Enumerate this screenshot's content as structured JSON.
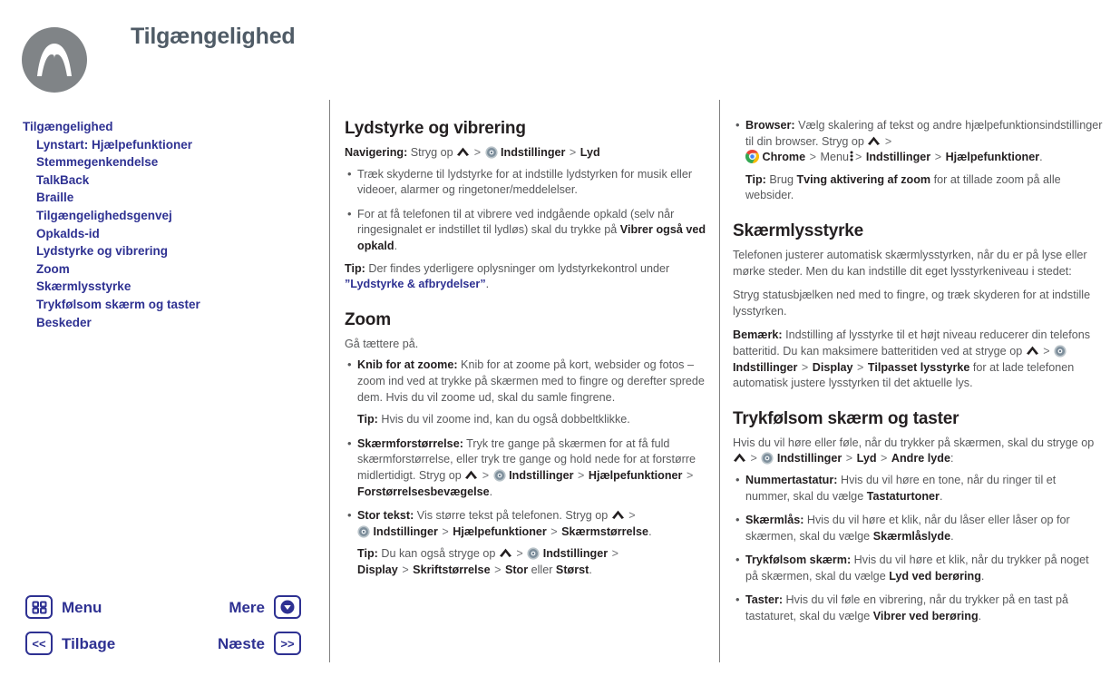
{
  "header": {
    "title": "Tilgængelighed",
    "logo_name": "motorola-logo"
  },
  "sidebar": {
    "items": [
      {
        "label": "Tilgængelighed",
        "level": 0
      },
      {
        "label": "Lynstart: Hjælpefunktioner",
        "level": 1
      },
      {
        "label": "Stemmegenkendelse",
        "level": 1
      },
      {
        "label": "TalkBack",
        "level": 1
      },
      {
        "label": "Braille",
        "level": 1
      },
      {
        "label": "Tilgængelighedsgenvej",
        "level": 1
      },
      {
        "label": "Opkalds-id",
        "level": 1
      },
      {
        "label": "Lydstyrke og vibrering",
        "level": 1
      },
      {
        "label": "Zoom",
        "level": 1
      },
      {
        "label": "Skærmlysstyrke",
        "level": 1
      },
      {
        "label": "Trykfølsom skærm og taster",
        "level": 1
      },
      {
        "label": "Beskeder",
        "level": 1
      }
    ]
  },
  "bottom_nav": {
    "menu_label": "Menu",
    "back_label": "Tilbage",
    "more_label": "Mere",
    "next_label": "Næste",
    "menu_icon": "grid-icon",
    "back_icon": "double-chevron-left-icon",
    "more_icon": "circle-chevron-down-icon",
    "next_icon": "double-chevron-right-icon"
  },
  "colors": {
    "nav_blue": "#2e3192",
    "body_grey": "#58595b",
    "heading_black": "#231f20",
    "logo_grey": "#808487",
    "title_slate": "#4f5b66"
  },
  "middle_column": {
    "section1": {
      "heading": "Lydstyrke og vibrering",
      "nav_label": "Navigering:",
      "nav_step1": "Stryg op",
      "nav_step2": "Indstillinger",
      "nav_step3": "Lyd",
      "bullet1": "Træk skyderne til lydstyrke for at indstille lydstyrken for musik eller videoer, alarmer og ringetoner/meddelelser.",
      "bullet2_a": "For at få telefonen til at vibrere ved indgående opkald (selv når ringesignalet er indstillet til lydløs) skal du trykke på ",
      "bullet2_b": "Vibrer også ved opkald",
      "bullet2_c": ".",
      "tip_label": "Tip:",
      "tip_a": " Der findes yderligere oplysninger om lydstyrkekontrol under ",
      "tip_link": "”Lydstyrke & afbrydelser”",
      "tip_c": "."
    },
    "section2": {
      "heading": "Zoom",
      "intro": "Gå tættere på.",
      "b1_label": "Knib for at zoome:",
      "b1_text": " Knib for at zoome på kort, websider og fotos – zoom ind ved at trykke på skærmen med to fingre og derefter sprede dem. Hvis du vil zoome ud, skal du samle fingrene.",
      "b1_tip_label": "Tip:",
      "b1_tip_text": " Hvis du vil zoome ind, kan du også dobbeltklikke.",
      "b2_label": "Skærmforstørrelse:",
      "b2_text": " Tryk tre gange på skærmen for at få fuld skærmforstørrelse, eller tryk tre gange og hold nede for at forstørre midlertidigt. Stryg op",
      "b2_step_settings": "Indstillinger",
      "b2_step_access": "Hjælpefunktioner",
      "b2_step_last": "Forstørrelsesbevægelse",
      "b3_label": "Stor tekst:",
      "b3_text": " Vis større tekst på telefonen. Stryg op",
      "b3_step_settings": "Indstillinger",
      "b3_step_access": "Hjælpefunktioner",
      "b3_step_last": "Skærmstørrelse",
      "b3_tip_label": "Tip:",
      "b3_tip_text": " Du kan også stryge op",
      "b3_tip_settings": "Indstillinger",
      "b3_tip_display": "Display",
      "b3_tip_fontsize": "Skriftstørrelse",
      "b3_tip_stor": "Stor",
      "b3_tip_or": " eller ",
      "b3_tip_storst": "Størst",
      "b3_tip_end": "."
    }
  },
  "right_column": {
    "browser_bullet": {
      "label": "Browser:",
      "text": " Vælg skalering af tekst og andre hjælpefunktionsindstillinger til din browser. Stryg op",
      "chrome": "Chrome",
      "menu": "Menu",
      "settings": "Indstillinger",
      "accessibility": "Hjælpefunktioner",
      "end": ".",
      "tip_label": "Tip:",
      "tip_a": " Brug ",
      "tip_bold": "Tving aktivering af zoom",
      "tip_b": " for at tillade zoom på alle websider."
    },
    "section_brightness": {
      "heading": "Skærmlysstyrke",
      "p1": "Telefonen justerer automatisk skærmlysstyrken, når du er på lyse eller mørke steder. Men du kan indstille dit eget lysstyrkeniveau i stedet:",
      "p2": "Stryg statusbjælken ned med to fingre, og træk skyderen for at indstille lysstyrken.",
      "note_label": "Bemærk:",
      "note_a": " Indstilling af lysstyrke til et højt niveau reducerer din telefons batteritid. Du kan maksimere batteritiden ved at stryge op",
      "note_settings": "Indstillinger",
      "note_display": "Display",
      "note_custom": "Tilpasset lysstyrke",
      "note_b": " for at lade telefonen automatisk justere lysstyrken til det aktuelle lys."
    },
    "section_touch": {
      "heading": "Trykfølsom skærm og taster",
      "intro_a": "Hvis du vil høre eller føle, når du trykker på skærmen, skal du stryge op",
      "intro_settings": "Indstillinger",
      "intro_sound": "Lyd",
      "intro_other": "Andre lyde",
      "intro_end": ":",
      "b1_label": "Nummertastatur:",
      "b1_a": " Hvis du vil høre en tone, når du ringer til et nummer, skal du vælge ",
      "b1_bold": "Tastaturtoner",
      "b1_end": ".",
      "b2_label": "Skærmlås:",
      "b2_a": " Hvis du vil høre et klik, når du låser eller låser op for skærmen, skal du vælge ",
      "b2_bold": "Skærmlåslyde",
      "b2_end": ".",
      "b3_label": "Trykfølsom skærm:",
      "b3_a": " Hvis du vil høre et klik, når du trykker på noget på skærmen, skal du vælge ",
      "b3_bold": "Lyd ved berøring",
      "b3_end": ".",
      "b4_label": "Taster:",
      "b4_a": " Hvis du vil føle en vibrering, når du trykker på en tast på tastaturet, skal du vælge ",
      "b4_bold": "Vibrer ved berøring",
      "b4_end": "."
    }
  }
}
